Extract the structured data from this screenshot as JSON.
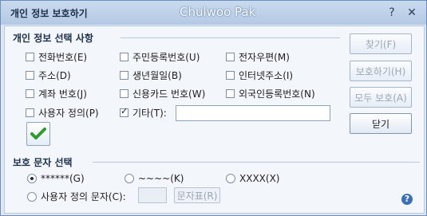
{
  "window": {
    "title": "개인 정보 보호하기",
    "name_overlay": "Chulwoo Pak",
    "help_glyph": "?",
    "close_glyph": "✕"
  },
  "personal_info": {
    "section_title": "개인 정보 선택 사항",
    "checkboxes": [
      {
        "label": "전화번호(E)",
        "checked": false
      },
      {
        "label": "주민등록번호(U)",
        "checked": false
      },
      {
        "label": "전자우편(M)",
        "checked": false
      },
      {
        "label": "주소(D)",
        "checked": false
      },
      {
        "label": "생년월일(B)",
        "checked": false
      },
      {
        "label": "인터넷주소(I)",
        "checked": false
      },
      {
        "label": "계좌 번호(J)",
        "checked": false
      },
      {
        "label": "신용카드 번호(W)",
        "checked": false
      },
      {
        "label": "외국인등록번호(N)",
        "checked": false
      },
      {
        "label": "사용자 정의(P)",
        "checked": false
      },
      {
        "label": "기타(T):",
        "checked": true
      }
    ],
    "other_value": "",
    "apply_icon": "checkmark-icon"
  },
  "buttons": {
    "find": "찾기(F)",
    "protect": "보호하기(H)",
    "protect_all": "모두 보호(A)",
    "close": "닫기"
  },
  "protect_char": {
    "section_title": "보호 문자 선택",
    "options": [
      {
        "label": "******(G)",
        "checked": true
      },
      {
        "label": "~~~~(K)",
        "checked": false
      },
      {
        "label": "XXXX(X)",
        "checked": false
      },
      {
        "label": "사용자 정의 문자(C):",
        "checked": false
      }
    ],
    "custom_value": "",
    "char_table_button": "문자표(R)"
  },
  "colors": {
    "accent": "#3b6fb8",
    "check_green": "#2f9a2f"
  }
}
